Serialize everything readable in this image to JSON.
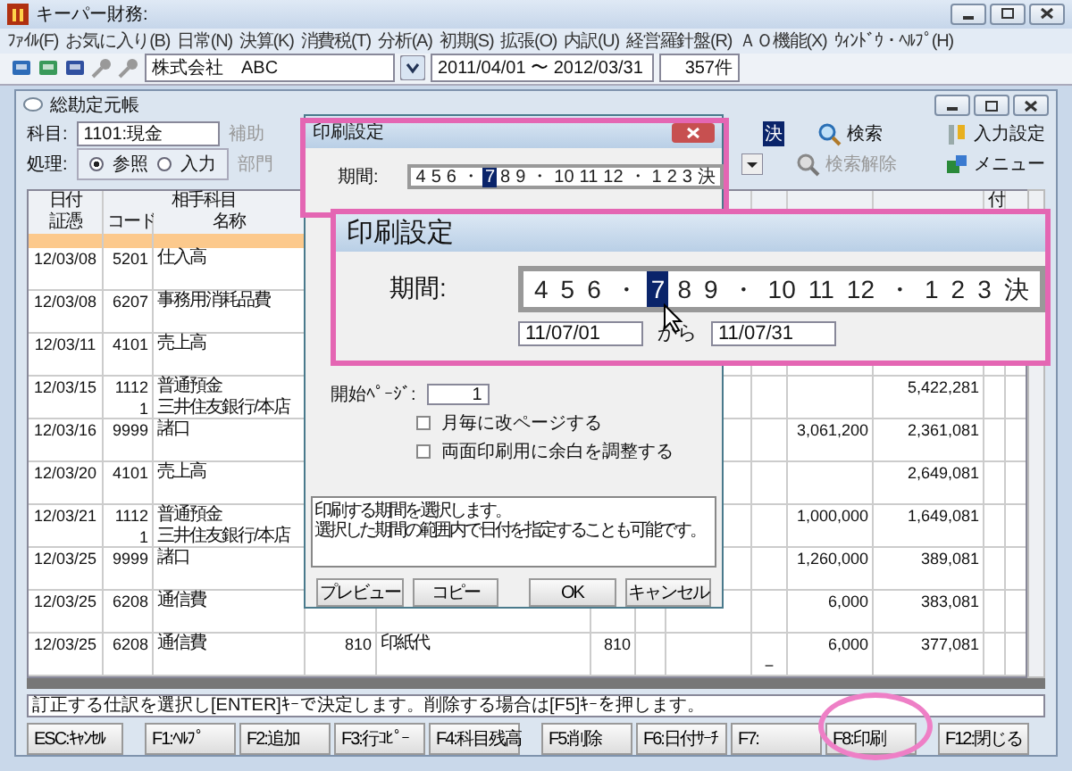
{
  "window": {
    "title": "キーパー財務:"
  },
  "menu": [
    "ﾌｧｲﾙ(F)",
    "お気に入り(B)",
    "日常(N)",
    "決算(K)",
    "消費税(T)",
    "分析(A)",
    "初期(S)",
    "拡張(O)",
    "内訳(U)",
    "経営羅針盤(R)",
    "ＡＯ機能(X)",
    "ｳｨﾝﾄﾞｳ・ﾍﾙﾌﾟ(H)"
  ],
  "toolbar": {
    "company": "株式会社　ABC",
    "period": "2011/04/01 〜 2012/03/31",
    "count": "357件"
  },
  "ledger": {
    "title": "総勘定元帳",
    "account_label": "科目:",
    "account": "1101:現金",
    "sub_label": "補助",
    "process_label": "処理:",
    "modes": [
      {
        "label": "参照",
        "selected": true
      },
      {
        "label": "入力",
        "selected": false
      }
    ],
    "dept_label": "部門",
    "period_end": "決",
    "actions": [
      {
        "kind": "search",
        "label": "検索",
        "disabled": false
      },
      {
        "kind": "settings",
        "label": "入力設定",
        "disabled": false
      },
      {
        "kind": "clear",
        "label": "検索解除",
        "disabled": true
      },
      {
        "kind": "menu",
        "label": "メニュー",
        "disabled": false
      }
    ]
  },
  "table": {
    "headers_top": [
      "日付",
      "相手科目"
    ],
    "headers_bottom": [
      "証憑",
      "コード",
      "名称"
    ],
    "header_right": "付",
    "rows": [
      {
        "date": "12/03/08",
        "code": "5201",
        "name": "仕入高"
      },
      {
        "date": "12/03/08",
        "code": "6207",
        "name": "事務用消耗品費"
      },
      {
        "date": "12/03/11",
        "code": "4101",
        "name": "売上高"
      },
      {
        "date": "12/03/15",
        "code": "1112",
        "name": "普通預金",
        "code_2": "1",
        "name_2": "三井住友銀行/本店",
        "balance": "5,422,281"
      },
      {
        "date": "12/03/16",
        "code": "9999",
        "name": "諸口",
        "amount": "3,061,200",
        "balance": "2,361,081"
      },
      {
        "date": "12/03/20",
        "code": "4101",
        "name": "売上高",
        "balance": "2,649,081"
      },
      {
        "date": "12/03/21",
        "code": "1112",
        "name": "普通預金",
        "code_2": "1",
        "name_2": "三井住友銀行/本店",
        "amount": "1,000,000",
        "balance": "1,649,081"
      },
      {
        "date": "12/03/25",
        "code": "9999",
        "name": "諸口",
        "amount": "1,260,000",
        "balance": "389,081"
      },
      {
        "date": "12/03/25",
        "code": "6208",
        "name": "通信費",
        "amount": "6,000",
        "balance": "383,081"
      },
      {
        "date": "12/03/25",
        "code": "6208",
        "name": "通信費",
        "sub_code": "810",
        "sub_name": "印紙代",
        "dept": "810",
        "amount": "6,000",
        "balance": "377,081",
        "mark_2": "−"
      }
    ]
  },
  "status_message": "訂正する仕訳を選択し[ENTER]ｷｰで決定します。削除する場合は[F5]ｷｰを押します。",
  "function_keys": [
    [
      "ESC:ｷｬﾝｾﾙ"
    ],
    [
      "F1:ﾍﾙﾌﾟ",
      "F2:追加",
      "F3:行ｺﾋﾟｰ",
      "F4:科目残高"
    ],
    [
      "F5:削除",
      "F6:日付ｻｰﾁ",
      "F7:",
      "F8:印刷"
    ],
    [
      "F12:閉じる"
    ]
  ],
  "print_dialog": {
    "title": "印刷設定",
    "period_label": "期間:",
    "months": [
      {
        "label": "4",
        "selected": false
      },
      {
        "label": "5",
        "selected": false
      },
      {
        "label": "6",
        "selected": false
      },
      {
        "label": "・",
        "selected": false
      },
      {
        "label": "7",
        "selected": true
      },
      {
        "label": "8",
        "selected": false
      },
      {
        "label": "9",
        "selected": false
      },
      {
        "label": "・",
        "selected": false
      },
      {
        "label": "10",
        "selected": false
      },
      {
        "label": "11",
        "selected": false
      },
      {
        "label": "12",
        "selected": false
      },
      {
        "label": "・",
        "selected": false
      },
      {
        "label": "1",
        "selected": false
      },
      {
        "label": "2",
        "selected": false
      },
      {
        "label": "3",
        "selected": false
      },
      {
        "label": "決",
        "selected": false
      }
    ],
    "start_page_label": "開始ﾍﾟｰｼﾞ:",
    "start_page": "1",
    "options": [
      {
        "label": "月毎に改ページする",
        "checked": false
      },
      {
        "label": "両面印刷用に余白を調整する",
        "checked": false
      }
    ],
    "help_lines": [
      "印刷する期間を選択します。",
      "選択した期間の範囲内で日付を指定することも可能です。"
    ],
    "buttons": [
      "プレビュー",
      "コピー",
      "OK",
      "キャンセル"
    ]
  },
  "zoom_callout": {
    "title": "印刷設定",
    "period_label": "期間:",
    "months": [
      {
        "label": "4",
        "selected": false
      },
      {
        "label": "5",
        "selected": false
      },
      {
        "label": "6",
        "selected": false
      },
      {
        "label": "・",
        "selected": false
      },
      {
        "label": "7",
        "selected": true
      },
      {
        "label": "8",
        "selected": false
      },
      {
        "label": "9",
        "selected": false
      },
      {
        "label": "・",
        "selected": false
      },
      {
        "label": "10",
        "selected": false
      },
      {
        "label": "11",
        "selected": false
      },
      {
        "label": "12",
        "selected": false
      },
      {
        "label": "・",
        "selected": false
      },
      {
        "label": "1",
        "selected": false
      },
      {
        "label": "2",
        "selected": false
      },
      {
        "label": "3",
        "selected": false
      },
      {
        "label": "決",
        "selected": false
      }
    ],
    "date_from": "11/07/01",
    "from_suffix": "から",
    "date_to": "11/07/31"
  }
}
